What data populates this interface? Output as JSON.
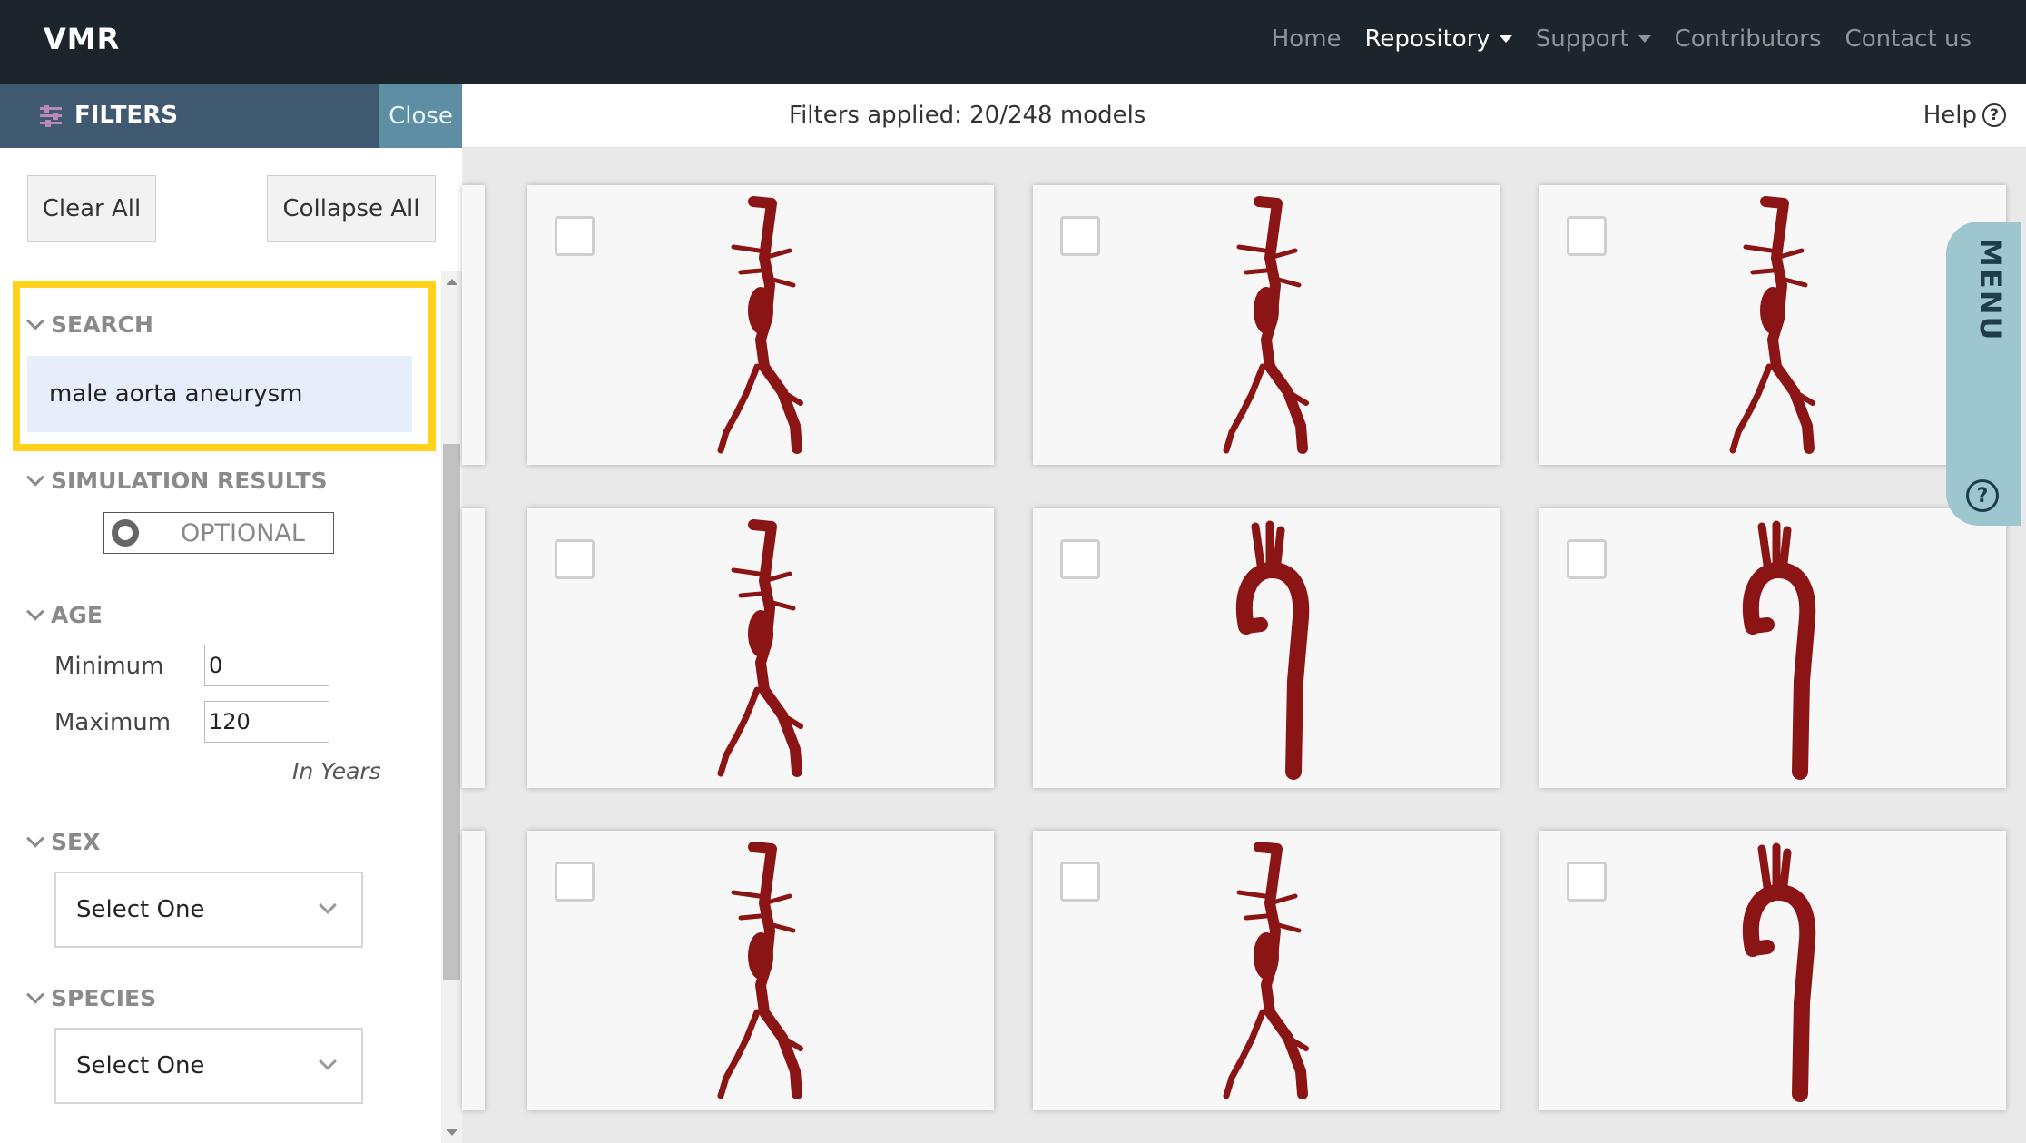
{
  "navbar": {
    "brand": "VMR",
    "items": [
      {
        "label": "Home",
        "active": false,
        "dropdown": false
      },
      {
        "label": "Repository",
        "active": true,
        "dropdown": true
      },
      {
        "label": "Support",
        "active": false,
        "dropdown": true
      },
      {
        "label": "Contributors",
        "active": false,
        "dropdown": false
      },
      {
        "label": "Contact us",
        "active": false,
        "dropdown": false
      }
    ]
  },
  "filters": {
    "title": "FILTERS",
    "close_label": "Close",
    "clear_all_label": "Clear All",
    "collapse_all_label": "Collapse All"
  },
  "status": {
    "text": "Filters applied: 20/248 models",
    "help_label": "Help"
  },
  "sections": {
    "search": {
      "title": "SEARCH",
      "value": "male aorta aneurysm"
    },
    "simulation": {
      "title": "SIMULATION RESULTS",
      "toggle_label": "OPTIONAL"
    },
    "age": {
      "title": "AGE",
      "min_label": "Minimum",
      "min_value": "0",
      "max_label": "Maximum",
      "max_value": "120",
      "hint": "In Years"
    },
    "sex": {
      "title": "SEX",
      "selected": "Select One"
    },
    "species": {
      "title": "SPECIES",
      "selected": "Select One"
    }
  },
  "menu_tab": {
    "label": "MENU"
  },
  "colors": {
    "navbar_bg": "#1c252c",
    "filters_header_bg": "#3f5a70",
    "close_bg": "#5e8ea4",
    "highlight": "#ffd219",
    "vessel": "#8b1414",
    "menu_tab_bg": "#9ec6cf"
  },
  "models": [
    {
      "shape": "abdominal-aorta"
    },
    {
      "shape": "abdominal-aorta"
    },
    {
      "shape": "abdominal-aorta"
    },
    {
      "shape": "abdominal-aorta"
    },
    {
      "shape": "aortic-arch"
    },
    {
      "shape": "aortic-arch"
    },
    {
      "shape": "abdominal-aorta"
    },
    {
      "shape": "abdominal-aorta"
    },
    {
      "shape": "aortic-arch"
    }
  ]
}
